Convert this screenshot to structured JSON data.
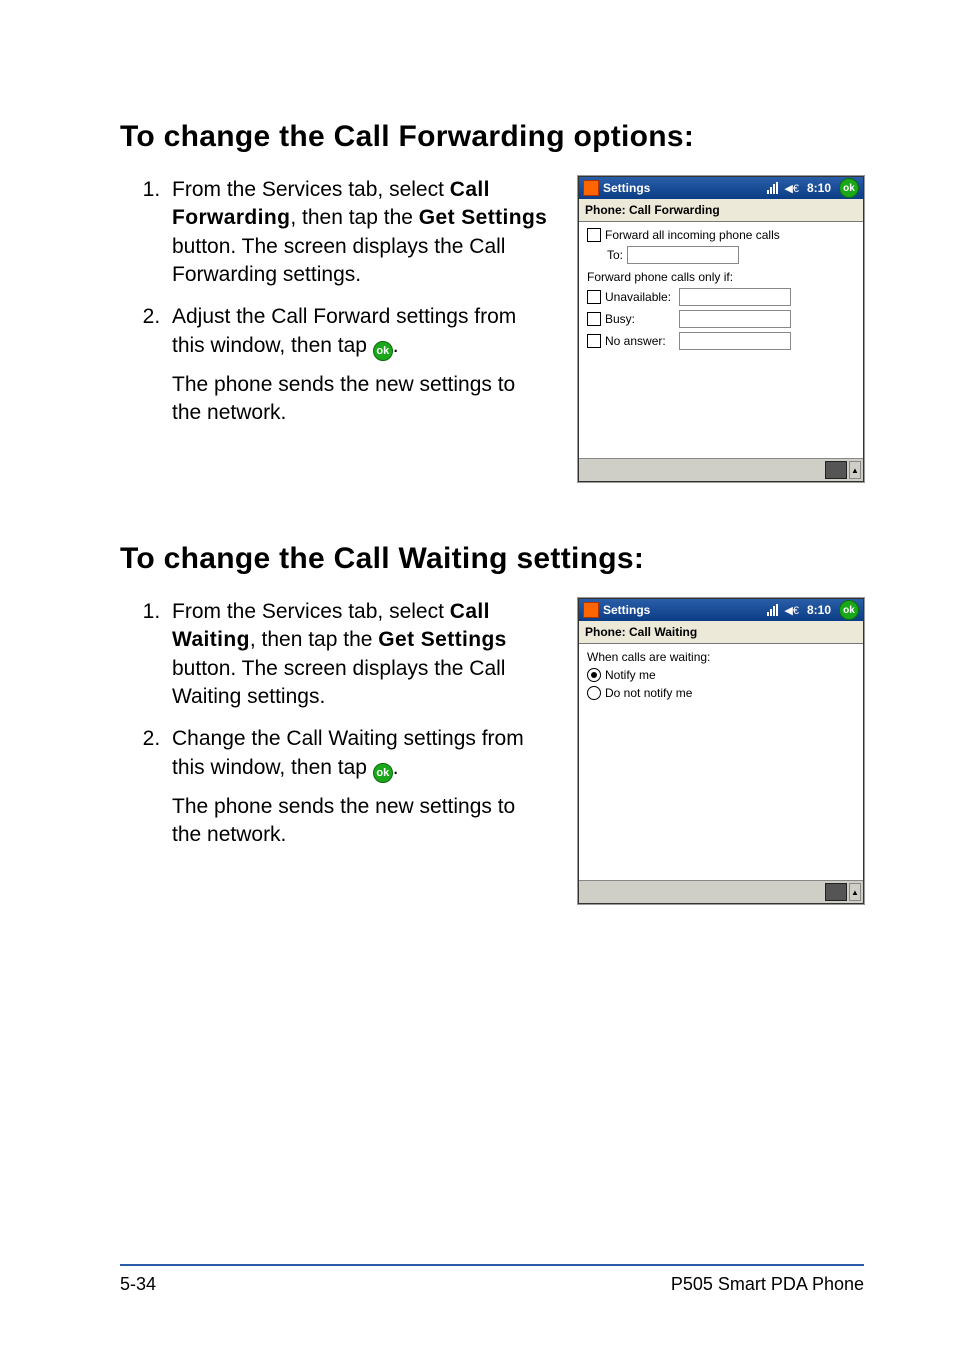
{
  "section1": {
    "heading": "To change the Call Forwarding options:",
    "steps": [
      {
        "prefix": "From the Services tab, select ",
        "bold1": "Call Forwarding",
        "mid": ", then tap the ",
        "bold2": "Get Settings",
        "suffix": " button. The screen displays the Call Forwarding settings."
      },
      {
        "text": "Adjust the Call Forward settings from this window, then tap ",
        "after_ok": ".",
        "result": "The phone sends the new settings to the network."
      }
    ],
    "screenshot": {
      "title": "Settings",
      "time": "8:10",
      "ok": "ok",
      "subhead": "Phone: Call Forwarding",
      "row_forward_all": "Forward all incoming phone calls",
      "to_label": "To:",
      "only_if": "Forward phone calls only if:",
      "unavailable": "Unavailable:",
      "busy": "Busy:",
      "noanswer": "No answer:"
    }
  },
  "section2": {
    "heading": "To change the Call Waiting settings:",
    "steps": [
      {
        "prefix": "From the Services tab, select ",
        "bold1": "Call Waiting",
        "mid": ", then tap the ",
        "bold2": "Get Settings",
        "suffix": " button. The screen displays the Call Waiting settings."
      },
      {
        "text": "Change the Call Waiting settings from this window, then tap ",
        "after_ok": ".",
        "result": "The phone sends the new settings to the network."
      }
    ],
    "screenshot": {
      "title": "Settings",
      "time": "8:10",
      "ok": "ok",
      "subhead": "Phone: Call Waiting",
      "when": "When calls are waiting:",
      "notify": "Notify me",
      "donot": "Do not notify me"
    }
  },
  "footer": {
    "page": "5-34",
    "doc": "P505 Smart PDA Phone"
  }
}
